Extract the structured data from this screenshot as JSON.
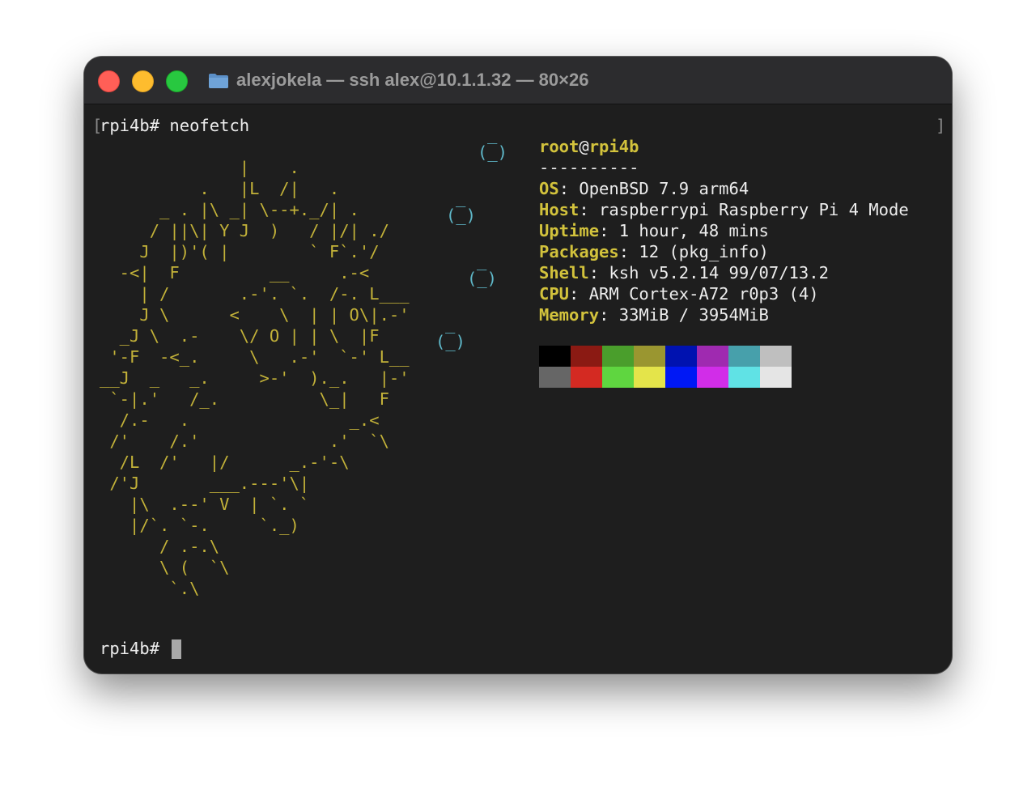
{
  "window": {
    "title": "alexjokela — ssh alex@10.1.1.32 — 80×26",
    "folder_icon": "folder-icon"
  },
  "terminal": {
    "command_line": "rpi4b# neofetch",
    "open_bracket": "[",
    "close_bracket": "]",
    "ascii_art": [
      {
        "cls": "c",
        "text": "                                                    _"
      },
      {
        "cls": "c",
        "text": "                                                  (_)"
      },
      {
        "cls": "y",
        "text": "              |    ."
      },
      {
        "cls": "y",
        "text": "          .   |L  /|   ."
      },
      {
        "cls": "y",
        "text": "      _ . |\\ _| \\--+._/| ."
      },
      {
        "cls": "y",
        "text": "     / ||\\| Y J  )   / |/| ./"
      },
      {
        "cls": "y",
        "text": "    J  |)'( |        ` F`.'/"
      },
      {
        "cls": "y",
        "text": "  -<|  F         __     .-<"
      },
      {
        "cls": "y",
        "text": "    | /       .-'. `.  /-. L___"
      },
      {
        "cls": "y",
        "text": "    J \\      <    \\  | | O\\|.-'"
      },
      {
        "cls": "y",
        "text": "  _J \\  .-    \\/ O | | \\  |F"
      },
      {
        "cls": "y",
        "text": " '-F  -<_.     \\   .-'  `-' L__"
      },
      {
        "cls": "y",
        "text": "__J  _   _.     >-'  )._.   |-'"
      },
      {
        "cls": "y",
        "text": " `-|.'   /_.          \\_|   F"
      },
      {
        "cls": "y",
        "text": "  /.-   .                _.<"
      },
      {
        "cls": "y",
        "text": " /'    /.'             .'  `\\"
      },
      {
        "cls": "y",
        "text": "  /L  /'   |/      _.-'-\\"
      },
      {
        "cls": "y",
        "text": " /'J       ___.---'\\|"
      },
      {
        "cls": "y",
        "text": "   |\\  .--' V  | `. `"
      },
      {
        "cls": "y",
        "text": "   |/`. `-.     `._)"
      },
      {
        "cls": "y",
        "text": "      / .-.\\"
      },
      {
        "cls": "y",
        "text": "      \\ (  `\\"
      },
      {
        "cls": "y",
        "text": "       `.\\"
      }
    ],
    "bubbles": [
      {
        "text": "_",
        "text2": "(_)"
      },
      {
        "text": "_",
        "text2": "(_)"
      },
      {
        "text": "_",
        "text2": "(_)"
      }
    ],
    "info": {
      "user": "root",
      "at": "@",
      "host": "rpi4b",
      "separator": "----------",
      "fields": [
        {
          "label": "OS",
          "value": ": OpenBSD 7.9 arm64"
        },
        {
          "label": "Host",
          "value": ": raspberrypi Raspberry Pi 4 Mode"
        },
        {
          "label": "Uptime",
          "value": ": 1 hour, 48 mins"
        },
        {
          "label": "Packages",
          "value": ": 12 (pkg_info)"
        },
        {
          "label": "Shell",
          "value": ": ksh v5.2.14 99/07/13.2"
        },
        {
          "label": "CPU",
          "value": ": ARM Cortex-A72 r0p3 (4)"
        },
        {
          "label": "Memory",
          "value": ": 33MiB / 3954MiB"
        }
      ]
    },
    "palette": {
      "row1": [
        "#000000",
        "#8b1a13",
        "#4a9e2c",
        "#9a9630",
        "#0012b0",
        "#9f2ab0",
        "#47a0ab",
        "#bfbfbf"
      ],
      "row2": [
        "#666666",
        "#d42a22",
        "#5fd640",
        "#e4e44a",
        "#0018f5",
        "#d12de8",
        "#60e2e5",
        "#e5e5e5"
      ]
    },
    "prompt": "rpi4b# "
  }
}
